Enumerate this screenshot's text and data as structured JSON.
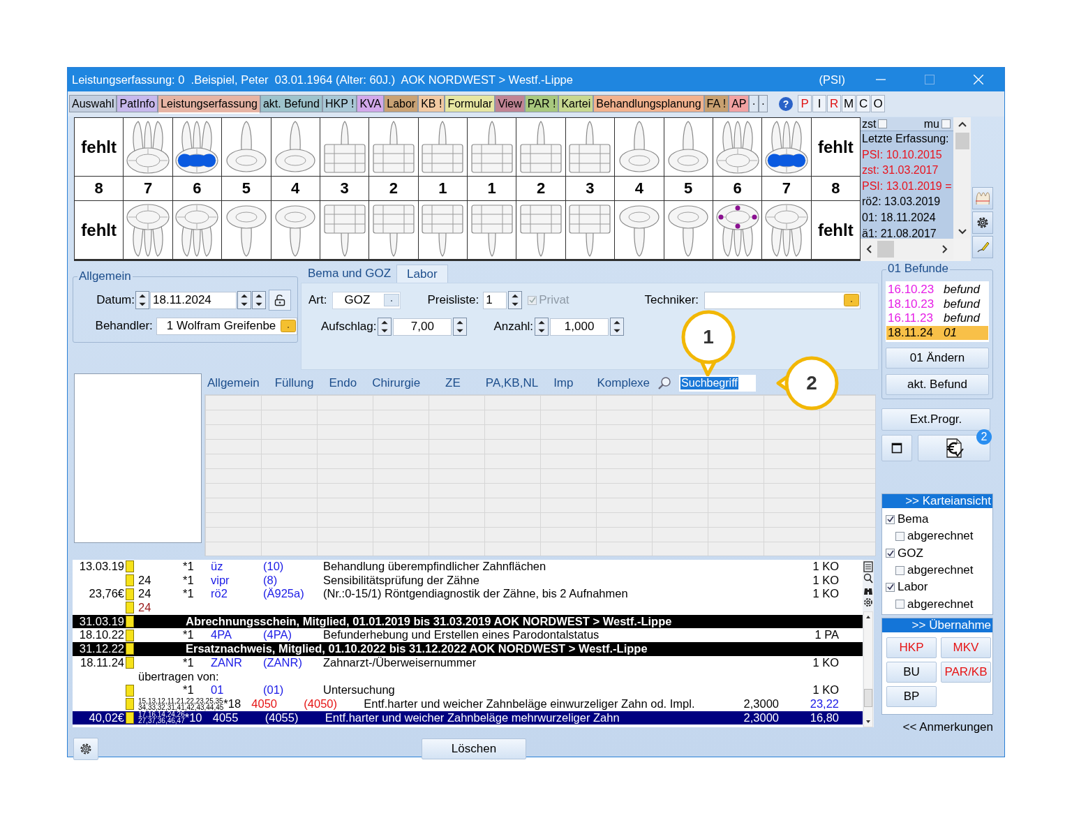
{
  "window": {
    "title": "Leistungserfassung: 0  .Beispiel, Peter  03.01.1964 (Alter: 60J.)  AOK NORDWEST > Westf.-Lippe",
    "badge": "(PSI)"
  },
  "tabs": [
    {
      "label": "Auswahl",
      "color": "#c4cfe0",
      "selected": false
    },
    {
      "label": "PatInfo",
      "color": "#c7b8ec",
      "selected": false
    },
    {
      "label": "Leistungserfassung",
      "color": "#e6b4a4",
      "selected": true
    },
    {
      "label": "akt. Befund",
      "color": "#9ec3cc",
      "selected": false
    },
    {
      "label": "HKP !",
      "color": "#a9c8d6",
      "selected": false
    },
    {
      "label": "KVA",
      "color": "#d2a8ea",
      "selected": false
    },
    {
      "label": "Labor",
      "color": "#c9a274",
      "selected": false
    },
    {
      "label": "KB !",
      "color": "#f1c9a2",
      "selected": false
    },
    {
      "label": "Formular",
      "color": "#e6e6a2",
      "selected": false
    },
    {
      "label": "View",
      "color": "#c08494",
      "selected": false
    },
    {
      "label": "PAR !",
      "color": "#a8c87e",
      "selected": false
    },
    {
      "label": "Kartei",
      "color": "#c8d890",
      "selected": false
    },
    {
      "label": "Behandlungsplanung",
      "color": "#f2b28e",
      "selected": false
    },
    {
      "label": "FA !",
      "color": "#c8a070",
      "selected": false
    },
    {
      "label": "AP",
      "color": "#f2a2a2",
      "selected": false
    },
    {
      "label": "·",
      "color": "#dce6f2",
      "selected": false
    },
    {
      "label": "·",
      "color": "#dce6f2",
      "selected": false
    }
  ],
  "help_button": "?",
  "quick_buttons": [
    {
      "label": "P",
      "color": "#e01414"
    },
    {
      "label": "I"
    },
    {
      "label": "R",
      "color": "#e01414"
    },
    {
      "label": "M"
    },
    {
      "label": "C"
    },
    {
      "label": "O"
    }
  ],
  "tooth_chart": {
    "upper": [
      {
        "kind": "missing",
        "label": "fehlt"
      },
      {
        "kind": "molar"
      },
      {
        "kind": "molar",
        "filling": true
      },
      {
        "kind": "premolar"
      },
      {
        "kind": "premolar"
      },
      {
        "kind": "anterior"
      },
      {
        "kind": "anterior"
      },
      {
        "kind": "anterior"
      },
      {
        "kind": "anterior"
      },
      {
        "kind": "anterior"
      },
      {
        "kind": "anterior"
      },
      {
        "kind": "premolar"
      },
      {
        "kind": "premolar"
      },
      {
        "kind": "molar"
      },
      {
        "kind": "molar",
        "filling": true
      },
      {
        "kind": "missing",
        "label": "fehlt"
      }
    ],
    "numbers": [
      "8",
      "7",
      "6",
      "5",
      "4",
      "3",
      "2",
      "1",
      "1",
      "2",
      "3",
      "4",
      "5",
      "6",
      "7",
      "8"
    ],
    "lower": [
      {
        "kind": "missing",
        "label": "fehlt"
      },
      {
        "kind": "molar"
      },
      {
        "kind": "molar"
      },
      {
        "kind": "premolar"
      },
      {
        "kind": "premolar"
      },
      {
        "kind": "anterior"
      },
      {
        "kind": "anterior"
      },
      {
        "kind": "anterior"
      },
      {
        "kind": "anterior"
      },
      {
        "kind": "anterior"
      },
      {
        "kind": "anterior"
      },
      {
        "kind": "premolar"
      },
      {
        "kind": "premolar"
      },
      {
        "kind": "molar",
        "marked": true
      },
      {
        "kind": "molar"
      },
      {
        "kind": "missing",
        "label": "fehlt"
      }
    ]
  },
  "chart_info": {
    "checks": [
      {
        "label": "zst",
        "checked": false
      },
      {
        "label": "mu",
        "checked": false
      }
    ],
    "lines": [
      {
        "text": "Letzte Erfassung:",
        "color": "#000000"
      },
      {
        "text": "PSI: 10.10.2015",
        "color": "#e8141e"
      },
      {
        "text": "zst: 31.03.2017",
        "color": "#e8141e"
      },
      {
        "text": "PSI: 13.01.2019 =",
        "color": "#e8141e"
      },
      {
        "text": "rö2: 13.03.2019",
        "color": "#000000"
      },
      {
        "text": "01: 18.11.2024",
        "color": "#000000"
      },
      {
        "text": "ä1: 21.08.2017",
        "color": "#000000"
      }
    ]
  },
  "allgemein": {
    "legend": "Allgemein",
    "date_label": "Datum:",
    "date": "18.11.2024",
    "dentist_label": "Behandler:",
    "dentist": "1 Wolfram Greifenbe"
  },
  "form_tabs": [
    {
      "label": "Bema und GOZ",
      "selected": false
    },
    {
      "label": "Labor",
      "selected": true
    }
  ],
  "labor": {
    "art_label": "Art:",
    "art": "GOZ",
    "price_label": "Preisliste:",
    "price": "1",
    "private": {
      "label": "Privat",
      "checked": true,
      "disabled": true
    },
    "tech_label": "Techniker:",
    "markup_label": "Aufschlag:",
    "markup": "7,00",
    "count_label": "Anzahl:",
    "count": "1,000"
  },
  "categories": [
    {
      "label": "Allgemein"
    },
    {
      "label": "Füllung"
    },
    {
      "label": "Endo"
    },
    {
      "label": "Chirurgie"
    },
    {
      "label": "ZE"
    },
    {
      "label": "PA,KB,NL"
    },
    {
      "label": "Imp"
    },
    {
      "label": "Komplexe"
    }
  ],
  "search": {
    "value": "Suchbegriff"
  },
  "callouts": [
    {
      "number": "1"
    },
    {
      "number": "2"
    }
  ],
  "ledger": [
    {
      "kind": "entry",
      "date": "13.03.19",
      "marker": true,
      "count": "*1",
      "code": "üz",
      "ref": "(10)",
      "text": "Behandlung überempfindlicher Zahnflächen",
      "amount": "1 KO",
      "color": "#1a1ae6",
      "selected": false
    },
    {
      "kind": "entry",
      "marker": true,
      "teeth": [
        "24"
      ],
      "count": "*1",
      "code": "vipr",
      "ref": "(8)",
      "text": "Sensibilitätsprüfung der Zähne",
      "amount": "1 KO",
      "color": "#1a1ae6",
      "selected": false
    },
    {
      "kind": "entry",
      "date": "23,76€",
      "marker": true,
      "teeth": [
        "24"
      ],
      "count": "*1",
      "code": "rö2",
      "ref": "(Ä925a)",
      "text": "(Nr.:0-15/1) Röntgendiagnostik der Zähne, bis 2 Aufnahmen",
      "amount": "1 KO",
      "color": "#1a1ae6",
      "selected": false
    },
    {
      "kind": "teeth",
      "marker": true,
      "teeth": [
        "24"
      ]
    },
    {
      "kind": "header",
      "date": "31.03.19",
      "marker": true,
      "text": "Abrechnungsschein, Mitglied, 01.01.2019 bis 31.03.2019  AOK NORDWEST > Westf.-Lippe"
    },
    {
      "kind": "entry",
      "date": "18.10.22",
      "marker": true,
      "count": "*1",
      "code": "4PA",
      "ref": "(4PA)",
      "text": "Befunderhebung und Erstellen eines Parodontalstatus",
      "amount": "1 PA",
      "color": "#1a1ae6",
      "selected": false
    },
    {
      "kind": "header",
      "date": "31.12.22",
      "marker": true,
      "text": "Ersatznachweis, Mitglied, 01.10.2022 bis 31.12.2022  AOK NORDWEST > Westf.-Lippe"
    },
    {
      "kind": "entry",
      "date": "18.11.24",
      "marker": true,
      "count": "*1",
      "code": "ZANR",
      "ref": "(ZANR)",
      "text": "Zahnarzt-/Überweisernummer",
      "amount": "1 KO",
      "color": "#1a1ae6",
      "selected": false
    },
    {
      "kind": "note",
      "marker": false,
      "text": "übertragen von:"
    },
    {
      "kind": "entry",
      "marker": true,
      "count": "*1",
      "code": "01",
      "ref": "(01)",
      "text": "Untersuchung",
      "amount": "1 KO",
      "color": "#1a1ae6",
      "selected": false
    },
    {
      "kind": "entry",
      "marker": true,
      "teeth": [
        "15,13,12,11,21,22,23,25,35",
        "34,33,32,31,41,42,43,44,45"
      ],
      "count": "*18",
      "code": "4050",
      "ref": "(4050)",
      "text": "Entf.harter und weicher Zahnbeläge einwurzeliger Zahn od. Impl.",
      "factor": "2,3000",
      "price": "23,22",
      "color": "#e61414",
      "selected": false
    },
    {
      "kind": "entry",
      "date": "40,02€",
      "marker": true,
      "teeth": [
        "17,16,14,24,26",
        "27,37,36,46,47"
      ],
      "count": "*10",
      "code": "4055",
      "ref": "(4055)",
      "text": "Entf.harter und weicher Zahnbeläge mehrwurzeliger Zahn",
      "factor": "2,3000",
      "price": "16,80",
      "selected": true
    }
  ],
  "befunde": {
    "title": "01 Befunde",
    "items": [
      {
        "date": "16.10.23",
        "label": "befund",
        "color": "#e61ee6",
        "selected": false
      },
      {
        "date": "18.10.23",
        "label": "befund",
        "color": "#e61ee6",
        "selected": false
      },
      {
        "date": "16.11.23",
        "label": "befund",
        "color": "#e61ee6",
        "selected": false
      },
      {
        "date": "18.11.24",
        "label": "01",
        "selected": true
      }
    ],
    "buttons": [
      "01 Ändern",
      "akt. Befund"
    ]
  },
  "ext_button": "Ext.Progr.",
  "invoice_badge": "2",
  "karteiansicht": {
    "title": ">> Karteiansicht",
    "items": [
      {
        "label": "Bema",
        "checked": true,
        "children": [
          {
            "label": "abgerechnet",
            "checked": false
          }
        ]
      },
      {
        "label": "GOZ",
        "checked": true,
        "children": [
          {
            "label": "abgerechnet",
            "checked": false
          }
        ]
      },
      {
        "label": "Labor",
        "checked": true,
        "children": [
          {
            "label": "abgerechnet",
            "checked": false
          }
        ]
      }
    ]
  },
  "uebernahme": {
    "title": ">> Übernahme",
    "buttons": [
      {
        "label": "HKP",
        "color": "#e61414"
      },
      {
        "label": "MKV",
        "color": "#e61414"
      },
      {
        "label": "BU",
        "color": "#000000"
      },
      {
        "label": "PAR/KB",
        "color": "#e61414"
      },
      {
        "label": "BP",
        "color": "#000000"
      }
    ]
  },
  "anmerkungen": "<< Anmerkungen",
  "footer": {
    "delete": "Löschen"
  }
}
